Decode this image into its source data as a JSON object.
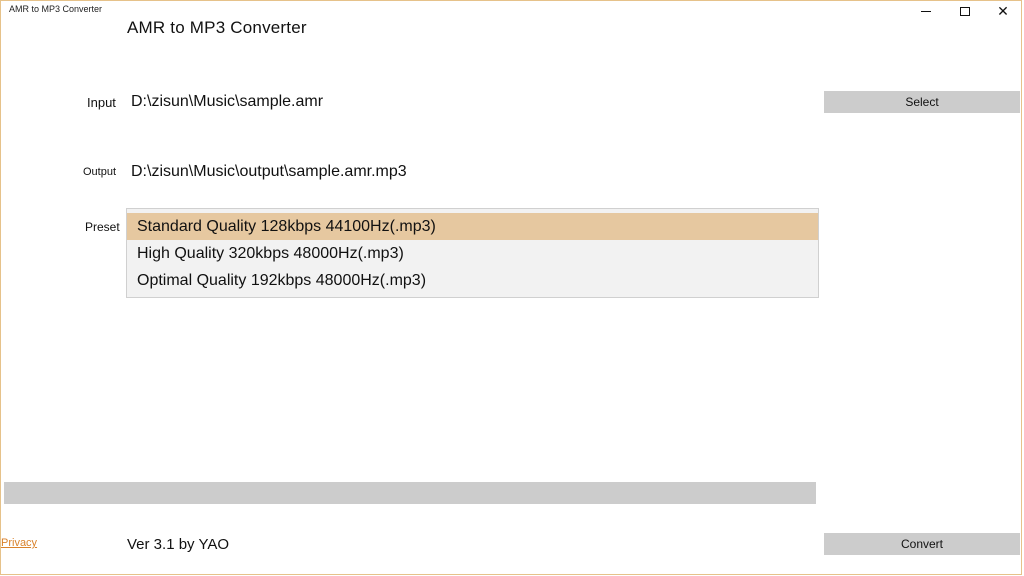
{
  "window": {
    "title": "AMR to MP3 Converter",
    "controls": {
      "minimize_icon": "minimize-icon",
      "maximize_icon": "maximize-icon",
      "close_icon": "close-icon",
      "close_glyph": "✕"
    },
    "accent_color": "#e6c8a0"
  },
  "app": {
    "heading": "AMR to MP3 Converter"
  },
  "input": {
    "label": "Input",
    "path": "D:\\zisun\\Music\\sample.amr",
    "select_label": "Select"
  },
  "output": {
    "label": "Output",
    "path": "D:\\zisun\\Music\\output\\sample.amr.mp3"
  },
  "preset": {
    "label": "Preset",
    "options": [
      "Standard Quality 128kbps 44100Hz(.mp3)",
      "High Quality 320kbps 48000Hz(.mp3)",
      "Optimal Quality 192kbps 48000Hz(.mp3)"
    ],
    "selected_index": 0
  },
  "progress": {
    "value": 0
  },
  "footer": {
    "privacy_label": "Privacy",
    "version": "Ver 3.1 by YAO",
    "convert_label": "Convert"
  }
}
